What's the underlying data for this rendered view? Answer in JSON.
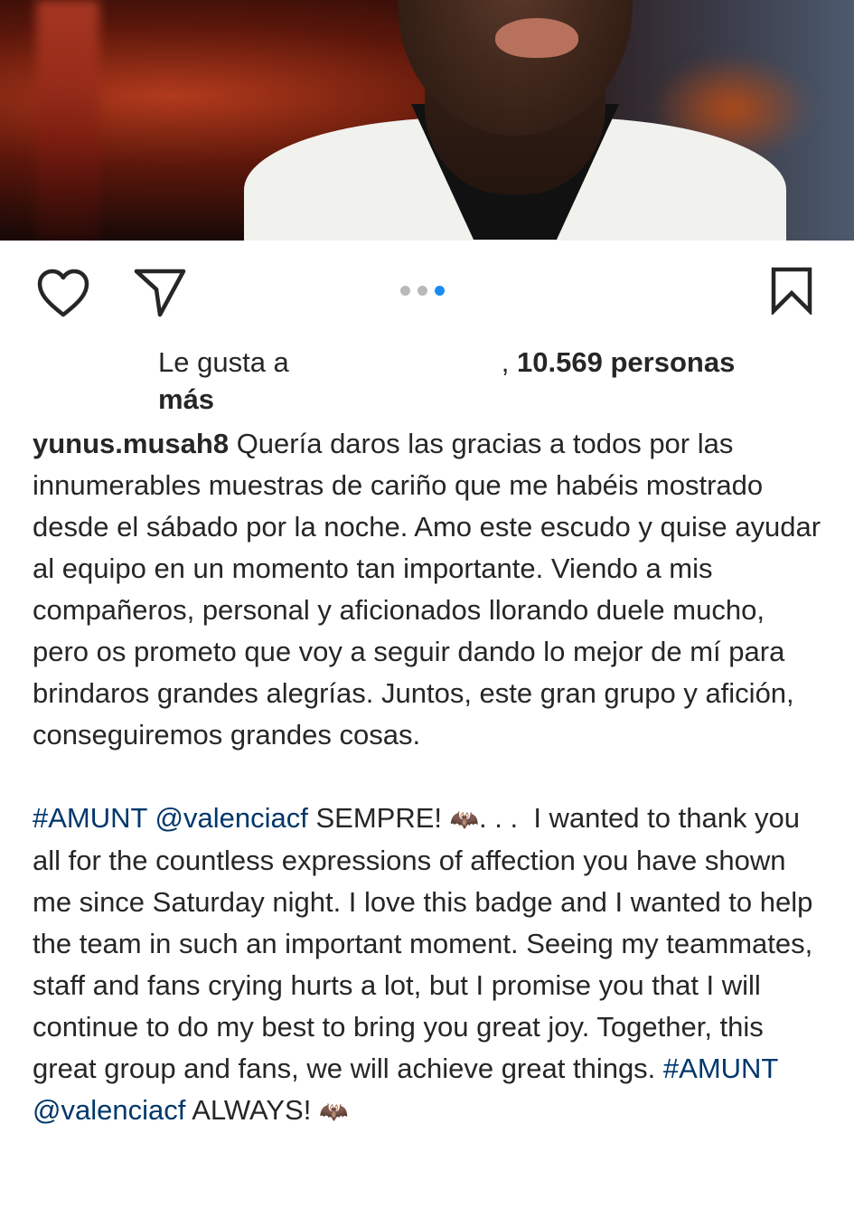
{
  "post": {
    "carousel": {
      "count": 3,
      "active_index": 2
    },
    "likes": {
      "prefix": "Le gusta a",
      "separator": ",",
      "count_text": "10.569 personas",
      "suffix": "más"
    },
    "caption": {
      "username": "yunus.musah8",
      "spanish_text": "Quería daros las gracias a todos por las innumerables muestras de cariño que me habéis mostrado desde el sábado por la noche. Amo este escudo y quise ayudar al equipo en un momento tan importante. Viendo a mis compañeros, personal y aficionados llorando duele mucho, pero os prometo que voy a seguir dando lo mejor de mí para brindaros grandes alegrías. Juntos, este gran grupo y afición, conseguiremos grandes cosas.",
      "hashtag_1": "#AMUNT",
      "mention_1": "@valenciacf",
      "sempre": "SEMPRE!",
      "bat_1": "🦇",
      "ellipsis": ". . .",
      "english_text": "I wanted to thank you all for the countless expressions of affection you have shown me since Saturday night. I love this badge and I wanted to help the team in such an important moment. Seeing my teammates, staff and fans crying hurts a lot, but I promise you that I will continue to do my best to bring you great joy. Together, this great group and fans, we will achieve great things.",
      "hashtag_2": "#AMUNT",
      "mention_2": "@valenciacf",
      "always": "ALWAYS!",
      "bat_2": "🦇"
    }
  },
  "colors": {
    "link": "#00376b",
    "carousel_active": "#1a8cf0",
    "carousel_inactive": "#b9b9b9",
    "text": "#262626"
  },
  "icons": {
    "like": "heart-outline-icon",
    "share": "paper-plane-icon",
    "save": "bookmark-outline-icon"
  }
}
